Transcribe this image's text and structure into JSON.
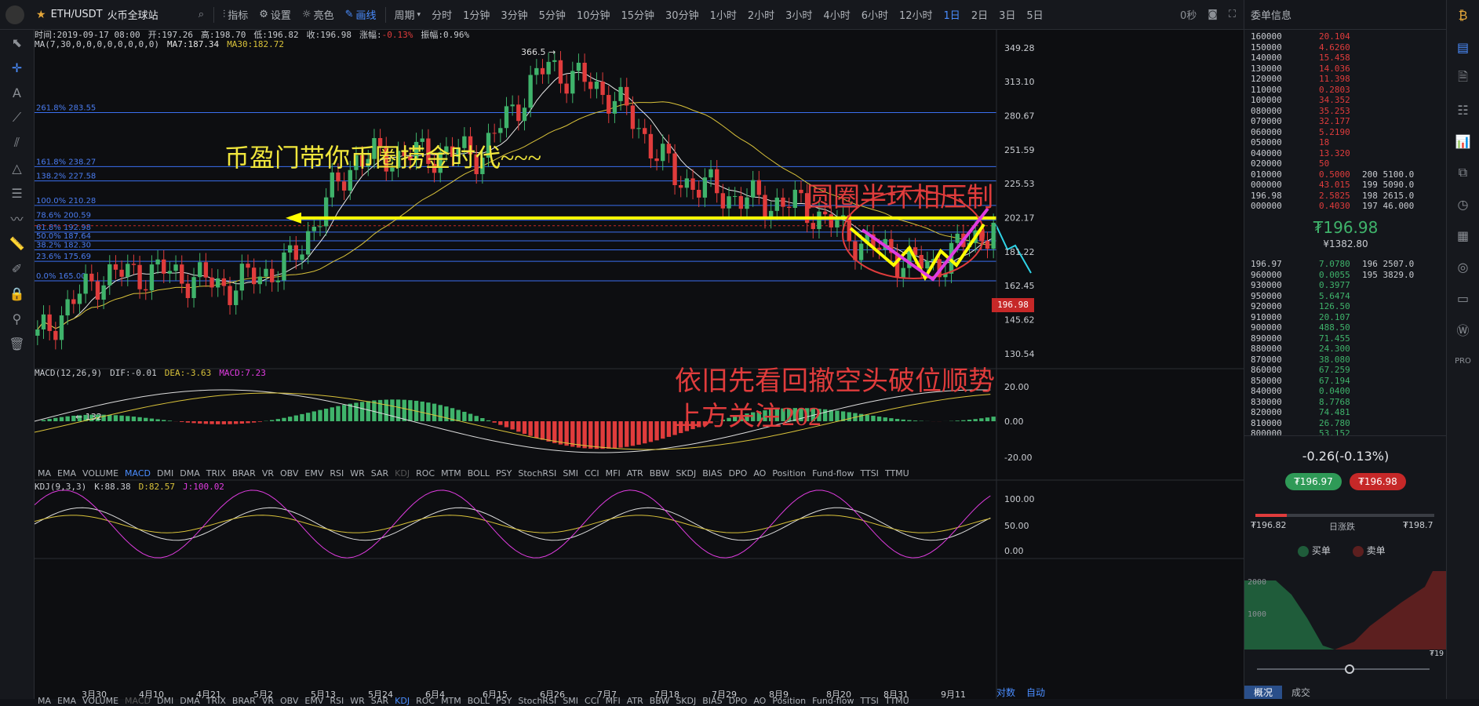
{
  "topbar": {
    "symbol": "ETH/USDT",
    "exchange": "火币全球站",
    "tools": [
      "指标",
      "设置",
      "亮色",
      "画线"
    ],
    "period_label": "周期",
    "periods": [
      "分时",
      "1分钟",
      "3分钟",
      "5分钟",
      "10分钟",
      "15分钟",
      "30分钟",
      "1小时",
      "2小时",
      "3小时",
      "4小时",
      "6小时",
      "12小时",
      "1日",
      "2日",
      "3日",
      "5日"
    ],
    "active_period": "1日",
    "countdown": "0秒"
  },
  "info": {
    "time_label": "时间:2019-09-17 08:00",
    "open": "开:197.26",
    "high": "高:198.70",
    "low": "低:196.82",
    "close": "收:196.98",
    "chg_label": "涨幅:",
    "chg": "-0.13%",
    "amp": "振幅:0.96%",
    "ma_label": "MA(7,30,0,0,0,0,0,0,0,0)",
    "ma7": "MA7:187.34",
    "ma30": "MA30:182.72"
  },
  "fib": [
    {
      "label": "261.8% 283.55",
      "v": 283.55
    },
    {
      "label": "161.8% 238.27",
      "v": 238.27
    },
    {
      "label": "138.2% 227.58",
      "v": 227.58
    },
    {
      "label": "100.0% 210.28",
      "v": 210.28
    },
    {
      "label": "78.6% 200.59",
      "v": 200.59
    },
    {
      "label": "61.8% 192.98",
      "v": 192.98
    },
    {
      "label": "50.0% 187.64",
      "v": 187.64
    },
    {
      "label": "38.2% 182.30",
      "v": 182.3
    },
    {
      "label": "23.6% 175.69",
      "v": 175.69
    },
    {
      "label": "0.0% 165.00",
      "v": 165.0
    }
  ],
  "annotations": {
    "title": "币盈门带你币圈捞金时代~~~",
    "circle": "圆圈半环相压制",
    "note1": "依旧先看回撤空头破位顺势",
    "note2": "上方关注202",
    "high_mark": "366.5",
    "low_mark": "132"
  },
  "price_axis": [
    "349.28",
    "313.10",
    "280.67",
    "251.59",
    "225.53",
    "202.17",
    "181.22",
    "162.45",
    "145.62",
    "130.54"
  ],
  "current_price": "196.98",
  "macd": {
    "label": "MACD(12,26,9)",
    "dif": "DIF:-0.01",
    "dea": "DEA:-3.63",
    "macd": "MACD:7.23",
    "axis": [
      "20.00",
      "0.00",
      "-20.00"
    ]
  },
  "kdj": {
    "label": "KDJ(9,3,3)",
    "k": "K:88.38",
    "d": "D:82.57",
    "j": "J:100.02",
    "axis": [
      "100.00",
      "50.00",
      "0.00"
    ]
  },
  "indicators": [
    "MA",
    "EMA",
    "VOLUME",
    "MACD",
    "DMI",
    "DMA",
    "TRIX",
    "BRAR",
    "VR",
    "OBV",
    "EMV",
    "RSI",
    "WR",
    "SAR",
    "KDJ",
    "ROC",
    "MTM",
    "BOLL",
    "PSY",
    "StochRSI",
    "SMI",
    "CCI",
    "MFI",
    "ATR",
    "BBW",
    "SKDJ",
    "BIAS",
    "DPO",
    "AO",
    "Position",
    "Fund-flow",
    "TTSI",
    "TTMU"
  ],
  "dates": [
    "3月30",
    "4月10",
    "4月21",
    "5月2",
    "5月13",
    "5月24",
    "6月4",
    "6月15",
    "6月26",
    "7月7",
    "7月18",
    "7月29",
    "8月9",
    "8月20",
    "8月31",
    "9月11"
  ],
  "bottom_right": [
    "对数",
    "自动"
  ],
  "orderbook": {
    "title": "委单信息",
    "rows": [
      [
        "160000",
        "20.104",
        ""
      ],
      [
        "150000",
        "4.6260",
        ""
      ],
      [
        "140000",
        "15.458",
        ""
      ],
      [
        "130000",
        "14.036",
        ""
      ],
      [
        "120000",
        "11.398",
        ""
      ],
      [
        "110000",
        "0.2803",
        ""
      ],
      [
        "100000",
        "34.352",
        ""
      ],
      [
        "080000",
        "35.253",
        ""
      ],
      [
        "070000",
        "32.177",
        ""
      ],
      [
        "060000",
        "5.2190",
        ""
      ],
      [
        "050000",
        "18",
        ""
      ],
      [
        "040000",
        "13.320",
        ""
      ],
      [
        "020000",
        "50",
        ""
      ],
      [
        "010000",
        "0.5000",
        "200  5100.0"
      ],
      [
        "000000",
        "43.015",
        "199  5090.0"
      ],
      [
        "196.98",
        "2.5825",
        "198  2615.0"
      ],
      [
        "000000",
        "0.4030",
        "197  46.000"
      ]
    ],
    "price": "₮196.98",
    "cny": "¥1382.80",
    "rows2": [
      [
        "196.97",
        "7.0780",
        "196  2507.0"
      ],
      [
        "960000",
        "0.0055",
        "195  3829.0"
      ],
      [
        "930000",
        "0.3977",
        ""
      ],
      [
        "950000",
        "5.6474",
        ""
      ],
      [
        "920000",
        "126.50",
        ""
      ],
      [
        "910000",
        "20.107",
        ""
      ],
      [
        "900000",
        "488.50",
        ""
      ],
      [
        "890000",
        "71.455",
        ""
      ],
      [
        "880000",
        "24.300",
        ""
      ],
      [
        "870000",
        "38.080",
        ""
      ],
      [
        "860000",
        "67.259",
        ""
      ],
      [
        "850000",
        "67.194",
        ""
      ],
      [
        "840000",
        "0.0400",
        ""
      ],
      [
        "830000",
        "8.7768",
        ""
      ],
      [
        "820000",
        "74.481",
        ""
      ],
      [
        "810000",
        "26.780",
        ""
      ],
      [
        "800000",
        "53.152",
        ""
      ]
    ],
    "change": "-0.26(-0.13%)",
    "buy_price": "₮196.97",
    "sell_price": "₮196.98",
    "low": "₮196.82",
    "high": "₮198.7",
    "range_label": "日涨跌",
    "buy": "买单",
    "sell": "卖单",
    "depth_y1": "2000",
    "depth_y2": "1000",
    "depth_x": "₮19",
    "tabs": [
      "概况",
      "成交"
    ]
  },
  "colors": {
    "up": "#3fb36b",
    "down": "#e03c3c",
    "fib": "#3a6ff0",
    "ma7": "#e6e6e6",
    "ma30": "#d9c23a",
    "yellow": "#ffff00",
    "magenta": "#e03ce0",
    "cyan": "#2fd3e6"
  },
  "chart_data": {
    "type": "candlestick",
    "title": "ETH/USDT 1日",
    "ylabel": "",
    "ylim": [
      125,
      370
    ],
    "y_scale": "log",
    "x": [
      "3月30",
      "4月10",
      "4月21",
      "5月2",
      "5月13",
      "5月24",
      "6月4",
      "6月15",
      "6月26",
      "7月7",
      "7月18",
      "7月29",
      "8月9",
      "8月20",
      "8月31",
      "9月11"
    ],
    "close_approx": [
      137,
      168,
      170,
      162,
      175,
      245,
      248,
      250,
      330,
      300,
      230,
      215,
      210,
      185,
      172,
      197
    ]
  }
}
